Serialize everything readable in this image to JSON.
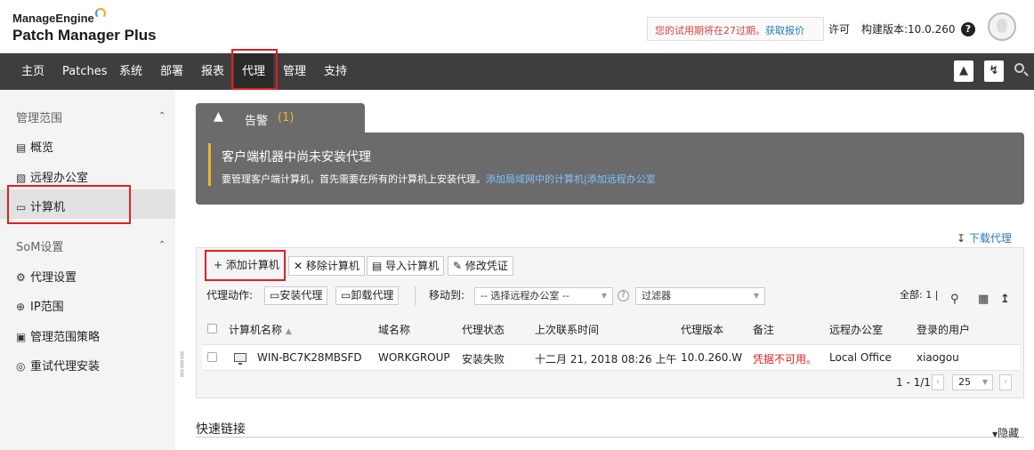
{
  "header": {
    "brand_top": "ManageEngine",
    "brand_name": "Patch Manager Plus",
    "trial_text": "您的试用期将在27过期。",
    "trial_link": "获取报价",
    "license": "许可",
    "build": "构建版本:10.0.260",
    "help": "?"
  },
  "nav": {
    "items": [
      "主页",
      "Patches",
      "系统",
      "部署",
      "报表",
      "代理",
      "管理",
      "支持"
    ],
    "active": "代理",
    "right_icons": [
      "rocket-icon",
      "flash-icon",
      "search-icon"
    ]
  },
  "sidebar": {
    "section1": "管理范围",
    "section1_items": [
      {
        "label": "概览",
        "icon": "document-icon"
      },
      {
        "label": "远程办公室",
        "icon": "office-icon"
      },
      {
        "label": "计算机",
        "icon": "computer-icon"
      }
    ],
    "section2": "SoM设置",
    "section2_items": [
      {
        "label": "代理设置",
        "icon": "settings-icon"
      },
      {
        "label": "IP范围",
        "icon": "globe-icon"
      },
      {
        "label": "管理范围策略",
        "icon": "policy-icon"
      },
      {
        "label": "重试代理安装",
        "icon": "retry-icon"
      }
    ],
    "active": "计算机"
  },
  "alert": {
    "tab_label": "告警",
    "tab_count": "(1)",
    "title": "客户端机器中尚未安装代理",
    "message": "要管理客户端计算机，首先需要在所有的计算机上安装代理。",
    "link1": "添加局域网中的计算机",
    "separator": "|",
    "link2": "添加远程办公室"
  },
  "download_agent": "下载代理",
  "toolbar": {
    "add": "+ 添加计算机",
    "remove": "✕ 移除计算机",
    "import": "导入计算机",
    "modify": "修改凭证"
  },
  "actions": {
    "label": "代理动作:",
    "install": "安装代理",
    "uninstall": "卸载代理",
    "move_to": "移动到:",
    "remote_office_select": "-- 选择远程办公室 --",
    "filter_select": "过滤器",
    "total": "全部: 1",
    "separator": "|"
  },
  "table": {
    "columns": [
      "计算机名称",
      "域名称",
      "代理状态",
      "上次联系时间",
      "代理版本",
      "备注",
      "远程办公室",
      "登录的用户"
    ],
    "rows": [
      {
        "name": "WIN-BC7K28MBSFD",
        "domain": "WORKGROUP",
        "status": "安装失败",
        "last_contact": "十二月 21, 2018 08:26 上午",
        "version": "10.0.260.W",
        "remark": "凭据不可用。",
        "office": "Local Office",
        "user": "xiaogou"
      }
    ]
  },
  "pagination": {
    "range": "1 - 1/1",
    "per_page": "25"
  },
  "quick_links": {
    "title": "快速链接",
    "hide": "隐藏"
  },
  "colors": {
    "nav_bg": "#3e3e3e",
    "alert_bg": "#6b6b6b",
    "highlight": "#e02020",
    "link": "#2a7ab8",
    "accent": "#f0b429"
  }
}
